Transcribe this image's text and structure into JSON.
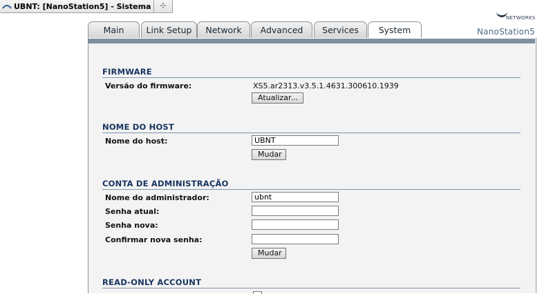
{
  "browser": {
    "tab_title": "UBNT: [NanoStation5] - Sistema",
    "new_tab_icon": "plus-icon"
  },
  "header": {
    "brand_text": "NETWORKS",
    "model": "NanoStation5"
  },
  "nav": {
    "tabs": [
      {
        "label": "Main"
      },
      {
        "label": "Link Setup"
      },
      {
        "label": "Network"
      },
      {
        "label": "Advanced"
      },
      {
        "label": "Services"
      },
      {
        "label": "System",
        "active": true
      }
    ]
  },
  "firmware": {
    "title": "FIRMWARE",
    "version_label": "Versão do firmware:",
    "version_value": "XS5.ar2313.v3.5.1.4631.300610.1939",
    "update_button": "Atualizar..."
  },
  "hostname": {
    "title": "NOME DO HOST",
    "label": "Nome do host:",
    "value": "UBNT",
    "button": "Mudar"
  },
  "admin": {
    "title": "CONTA DE ADMINISTRAÇÃO",
    "name_label": "Nome do administrador:",
    "name_value": "ubnt",
    "current_password_label": "Senha atual:",
    "new_password_label": "Senha nova:",
    "confirm_password_label": "Confirmar nova senha:",
    "button": "Mudar"
  },
  "readonly": {
    "title": "READ-ONLY ACCOUNT"
  },
  "colors": {
    "section_title": "#17345f",
    "band": "#7e8fa0",
    "content_bg": "#f3f3f3"
  }
}
